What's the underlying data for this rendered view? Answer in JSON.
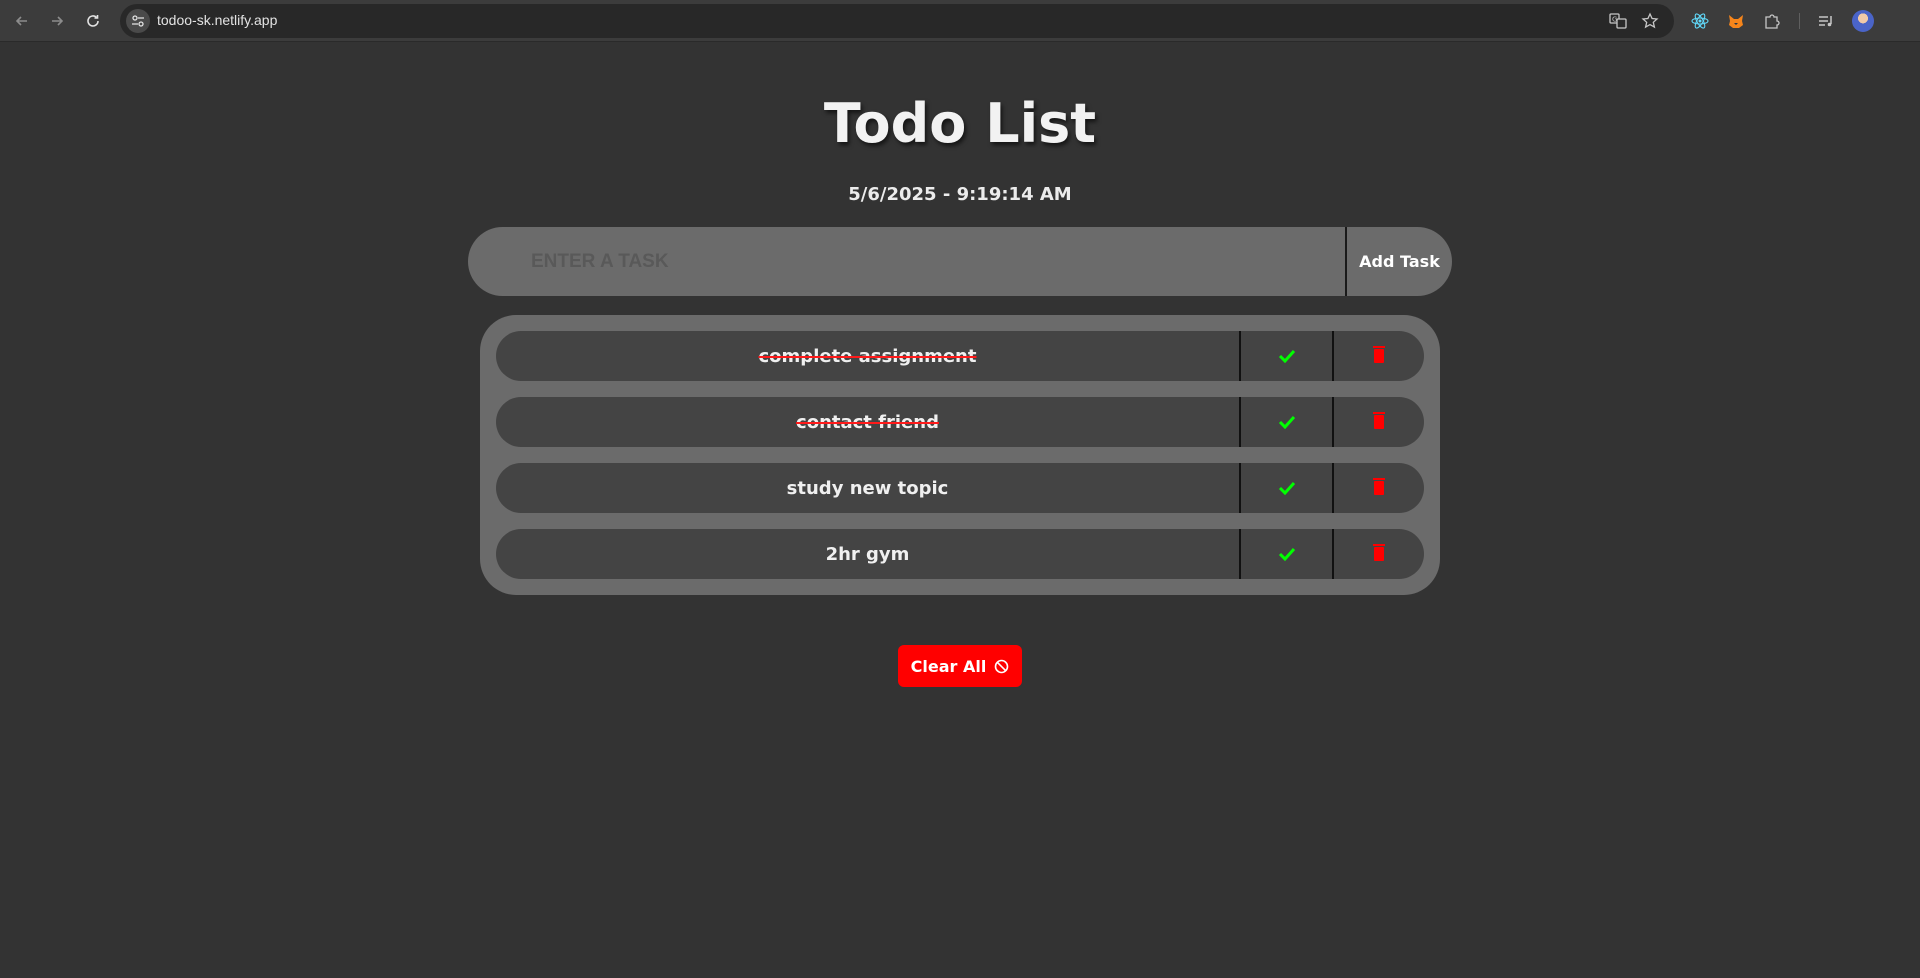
{
  "browser": {
    "url": "todoo-sk.netlify.app"
  },
  "app": {
    "title": "Todo List",
    "datetime": "5/6/2025 - 9:19:14 AM",
    "input": {
      "placeholder": "ENTER A TASK",
      "value": ""
    },
    "add_button_label": "Add Task",
    "tasks": [
      {
        "text": "complete assignment",
        "completed": true
      },
      {
        "text": "contact friend",
        "completed": true
      },
      {
        "text": "study new topic",
        "completed": false
      },
      {
        "text": "2hr gym",
        "completed": false
      }
    ],
    "clear_button_label": "Clear All"
  },
  "colors": {
    "background": "#333333",
    "panel": "#6b6b6b",
    "task_row": "#444444",
    "check": "#00ff00",
    "delete": "#ff0000",
    "clear_button": "#ff0000"
  },
  "icons": {
    "back": "arrow-left-icon",
    "forward": "arrow-right-icon",
    "reload": "reload-icon",
    "site_info": "tune-icon",
    "translate": "translate-icon",
    "bookmark": "star-icon",
    "check": "check-icon",
    "delete": "trash-icon",
    "clear": "ban-icon"
  }
}
